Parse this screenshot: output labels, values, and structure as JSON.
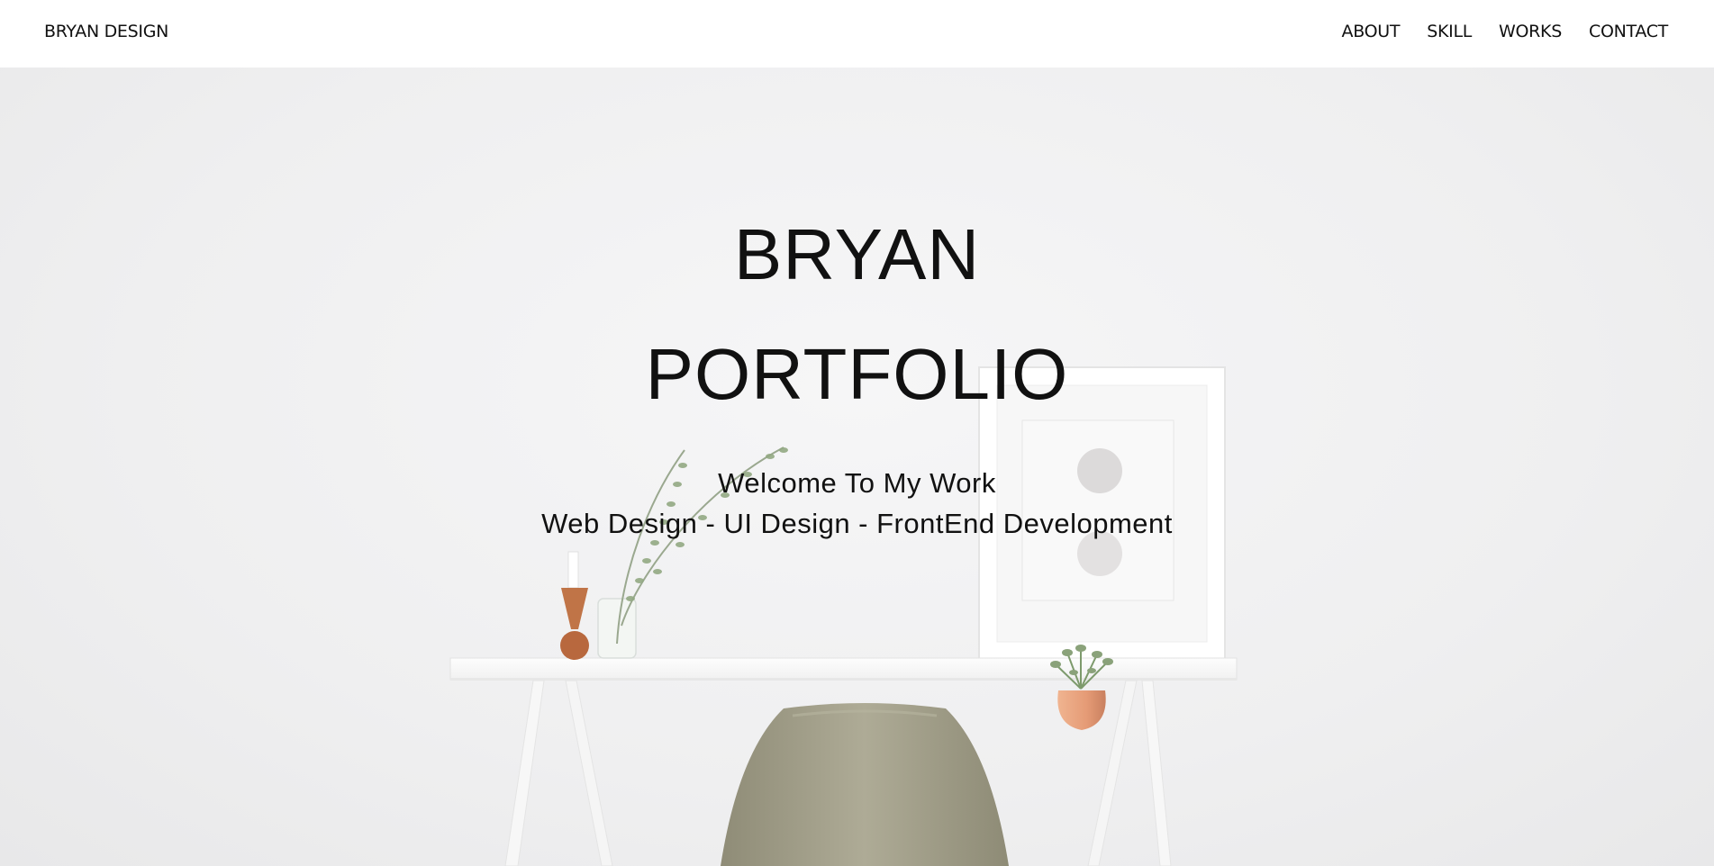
{
  "header": {
    "brand": "BRYAN DESIGN",
    "nav": [
      {
        "label": "ABOUT"
      },
      {
        "label": "SKILL"
      },
      {
        "label": "WORKS"
      },
      {
        "label": "CONTACT"
      }
    ]
  },
  "hero": {
    "title_line1": "BRYAN",
    "title_line2": "PORTFOLIO",
    "subtitle_line1": "Welcome To My Work",
    "subtitle_line2": "Web Design - UI Design - FrontEnd Development",
    "background_image": "minimal-desk-scene",
    "colors": {
      "wall": "#f0f0f1",
      "desk": "#fbfbfb",
      "chair": "#a8a590",
      "vase_wood": "#b8683e",
      "planter_copper": "#e8a27e",
      "plant_green": "#8aa27a"
    }
  }
}
